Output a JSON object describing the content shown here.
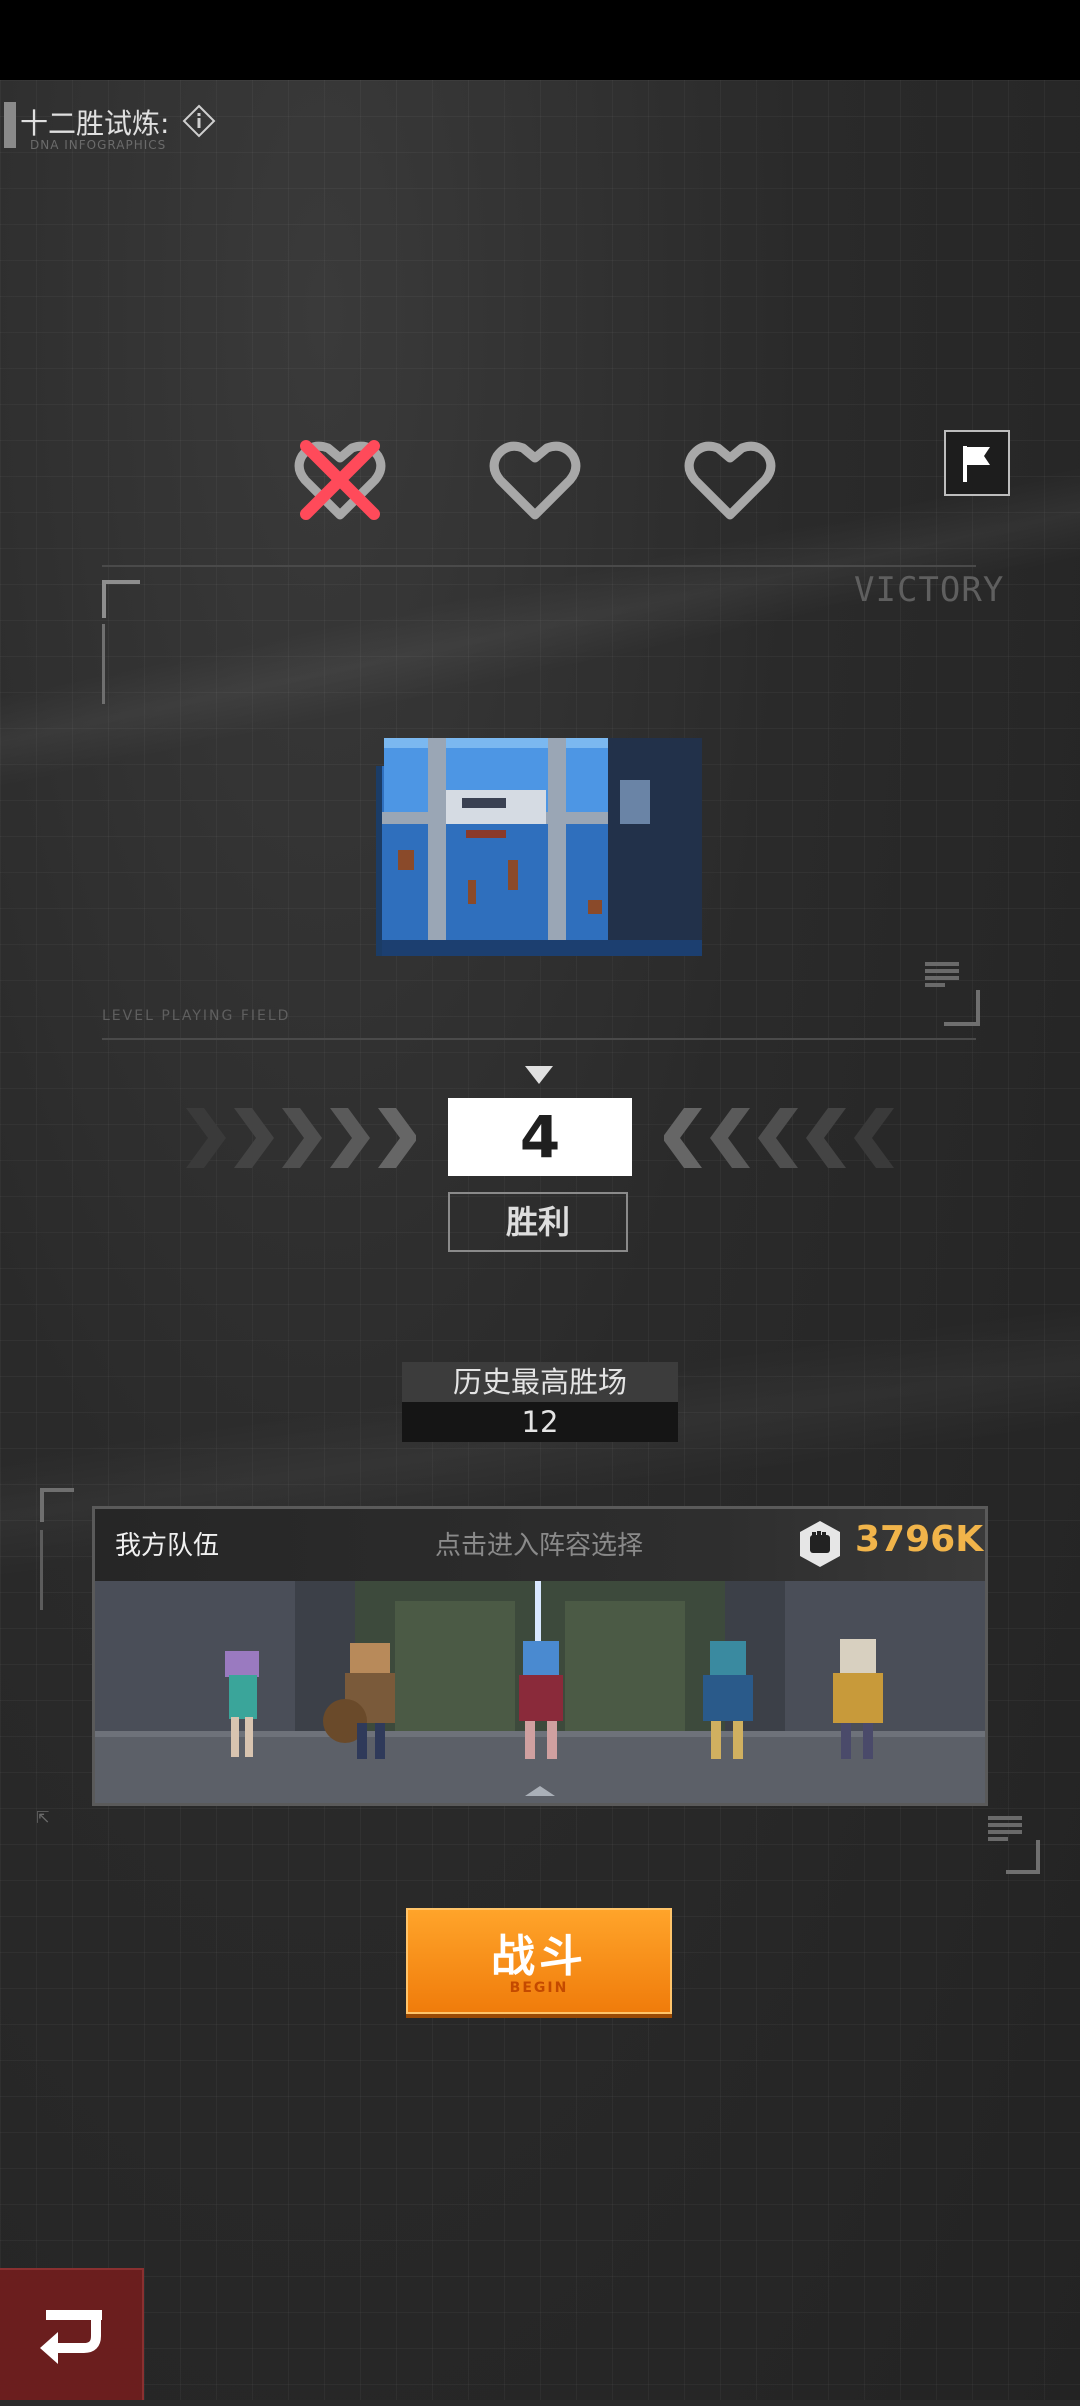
{
  "header": {
    "title": "十二胜试炼:",
    "subtitle": "DNA INFOGRAPHICS"
  },
  "lives": [
    {
      "state": "lost"
    },
    {
      "state": "remaining"
    },
    {
      "state": "remaining"
    }
  ],
  "banner": {
    "victory": "VICTORY",
    "level_text": "LEVEL PLAYING FIELD"
  },
  "result": {
    "wins": "4",
    "label": "胜利"
  },
  "record": {
    "title": "历史最高胜场",
    "value": "12"
  },
  "team": {
    "title": "我方队伍",
    "hint": "点击进入阵容选择",
    "power": "3796K"
  },
  "battle": {
    "label": "战斗",
    "sub": "BEGIN"
  },
  "colors": {
    "accent_orange": "#f28a12",
    "power_gold": "#f1b44a",
    "lost_red": "#ff4a5a",
    "back_red": "#6b1e1e"
  }
}
